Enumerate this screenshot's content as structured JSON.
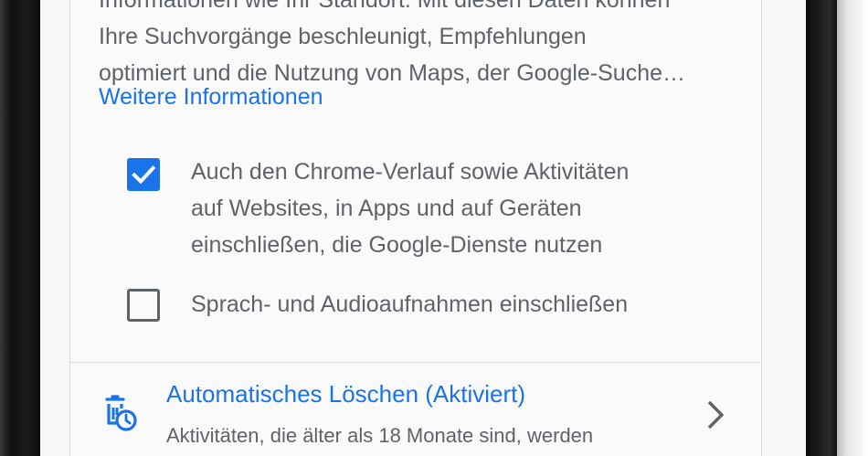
{
  "description": {
    "lines": [
      "Informationen wie Ihr Standort. Mit diesen Daten können",
      "Ihre Suchvorgänge beschleunigt, Empfehlungen",
      "optimiert und die Nutzung von Maps, der Google-Suche…"
    ],
    "more_link": "Weitere Informationen"
  },
  "options": [
    {
      "checked": true,
      "lines": [
        "Auch den Chrome-Verlauf sowie Aktivitäten",
        "auf Websites, in Apps und auf Geräten",
        "einschließen, die Google-Dienste nutzen"
      ]
    },
    {
      "checked": false,
      "lines": [
        "Sprach- und Audioaufnahmen einschließen"
      ]
    }
  ],
  "auto_delete": {
    "icon": "auto-delete-icon",
    "title": "Automatisches Löschen (Aktiviert)",
    "subtitle": "Aktivitäten, die älter als 18 Monate sind, werden"
  },
  "colors": {
    "accent": "#1a73e8",
    "text_secondary": "#5f6368",
    "card_bg": "#fafafa"
  }
}
